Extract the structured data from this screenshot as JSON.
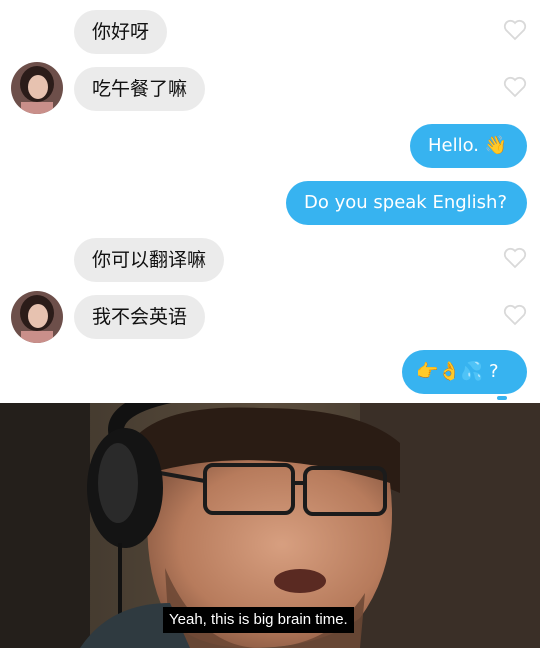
{
  "messages": [
    {
      "side": "received",
      "text": "你好呀"
    },
    {
      "side": "received",
      "text": "吃午餐了嘛"
    },
    {
      "side": "sent",
      "text": "Hello.",
      "emoji": "wave-hand-icon"
    },
    {
      "side": "sent",
      "text": "Do you speak English?"
    },
    {
      "side": "received",
      "text": "你可以翻译嘛"
    },
    {
      "side": "received",
      "text": "我不会英语"
    },
    {
      "side": "sent",
      "text": "?",
      "emoji": [
        "point-right-icon",
        "ok-hand-icon",
        "sweat-drops-icon"
      ]
    }
  ],
  "colors": {
    "sent_bubble": "#37b3f0",
    "received_bubble": "#ebebeb",
    "heart": "#d9d9d9"
  },
  "meme": {
    "caption": "Yeah, this is big brain time."
  }
}
